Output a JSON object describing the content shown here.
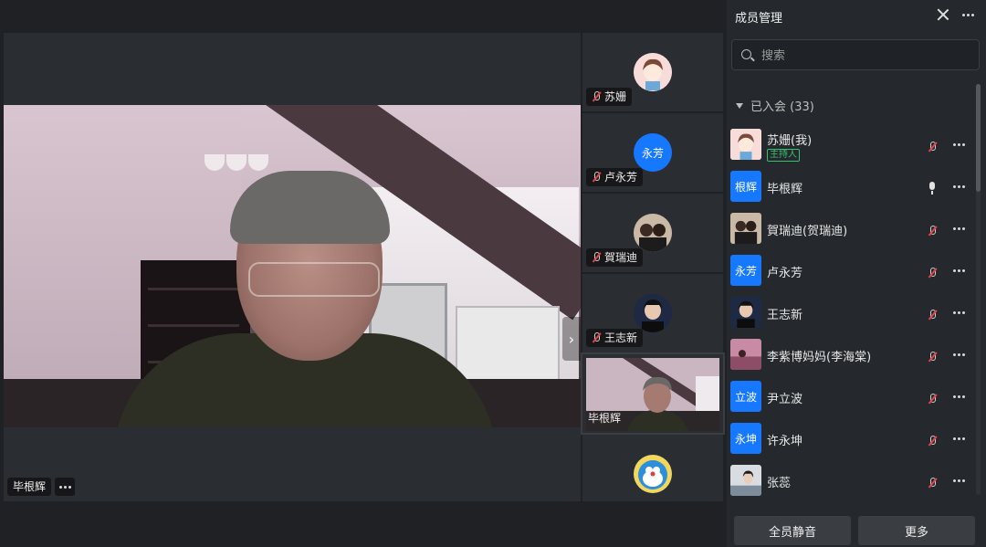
{
  "main_video": {
    "speaker_name": "毕根辉"
  },
  "thumbnails": [
    {
      "name": "苏姗",
      "avatar_text": "",
      "avatar_type": "photo-pink"
    },
    {
      "name": "卢永芳",
      "avatar_text": "永芳",
      "avatar_type": "initials-blue"
    },
    {
      "name": "賀瑞迪",
      "avatar_text": "",
      "avatar_type": "photo"
    },
    {
      "name": "王志新",
      "avatar_text": "",
      "avatar_type": "photo"
    },
    {
      "name": "毕根辉",
      "avatar_text": "",
      "avatar_type": "video"
    },
    {
      "name": "",
      "avatar_text": "",
      "avatar_type": "photo-doraemon"
    }
  ],
  "panel": {
    "title": "成员管理",
    "search_placeholder": "搜索",
    "group_label": "已入会 (33)",
    "host_badge": "主持人",
    "mute_all_label": "全员静音",
    "more_label": "更多"
  },
  "members": [
    {
      "name": "苏姗(我)",
      "avatar_text": "",
      "avatar_type": "photo-pink",
      "mic": "off",
      "host": true
    },
    {
      "name": "毕根辉",
      "avatar_text": "根辉",
      "avatar_type": "initials-blue",
      "mic": "on",
      "host": false
    },
    {
      "name": "賀瑞迪(贺瑞迪)",
      "avatar_text": "",
      "avatar_type": "photo",
      "mic": "off",
      "host": false
    },
    {
      "name": "卢永芳",
      "avatar_text": "永芳",
      "avatar_type": "initials-blue",
      "mic": "off",
      "host": false
    },
    {
      "name": "王志新",
      "avatar_text": "",
      "avatar_type": "photo",
      "mic": "off",
      "host": false
    },
    {
      "name": "李紫博妈妈(李海棠)",
      "avatar_text": "",
      "avatar_type": "photo",
      "mic": "off",
      "host": false
    },
    {
      "name": "尹立波",
      "avatar_text": "立波",
      "avatar_type": "initials-blue",
      "mic": "off",
      "host": false
    },
    {
      "name": "许永坤",
      "avatar_text": "永坤",
      "avatar_type": "initials-blue",
      "mic": "off",
      "host": false
    },
    {
      "name": "张蕊",
      "avatar_text": "",
      "avatar_type": "photo",
      "mic": "off",
      "host": false
    }
  ],
  "colors": {
    "accent": "#1677ff",
    "host_green": "#35c16f",
    "mic_off_red": "#e04646"
  }
}
